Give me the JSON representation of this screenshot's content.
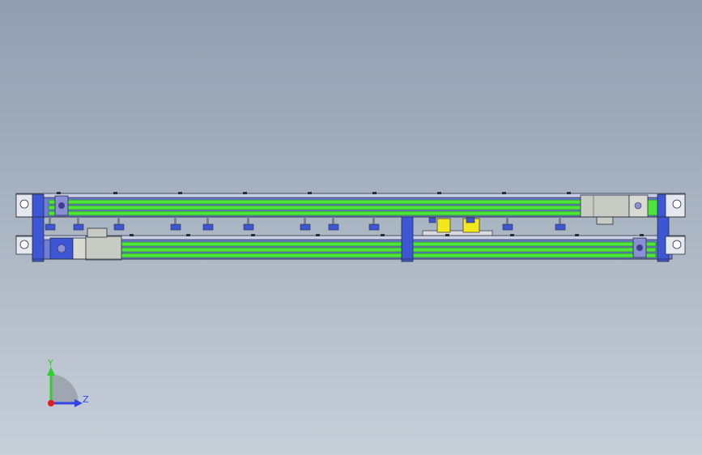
{
  "viewport": {
    "background_top": "#909eb0",
    "background_bottom": "#c7cfd9"
  },
  "colors": {
    "frame_blue": "#3d56d6",
    "rail_green": "#4ee63a",
    "rail_dark": "#1c6a12",
    "motor_gray": "#c8cbc4",
    "sensor_yellow": "#f2e61c",
    "outline": "#2a2f3a"
  },
  "triad": {
    "y_label": "Y",
    "z_label": "Z",
    "y_color": "#2fcf2f",
    "z_color": "#2f45e6",
    "x_color": "#e61c1c"
  }
}
